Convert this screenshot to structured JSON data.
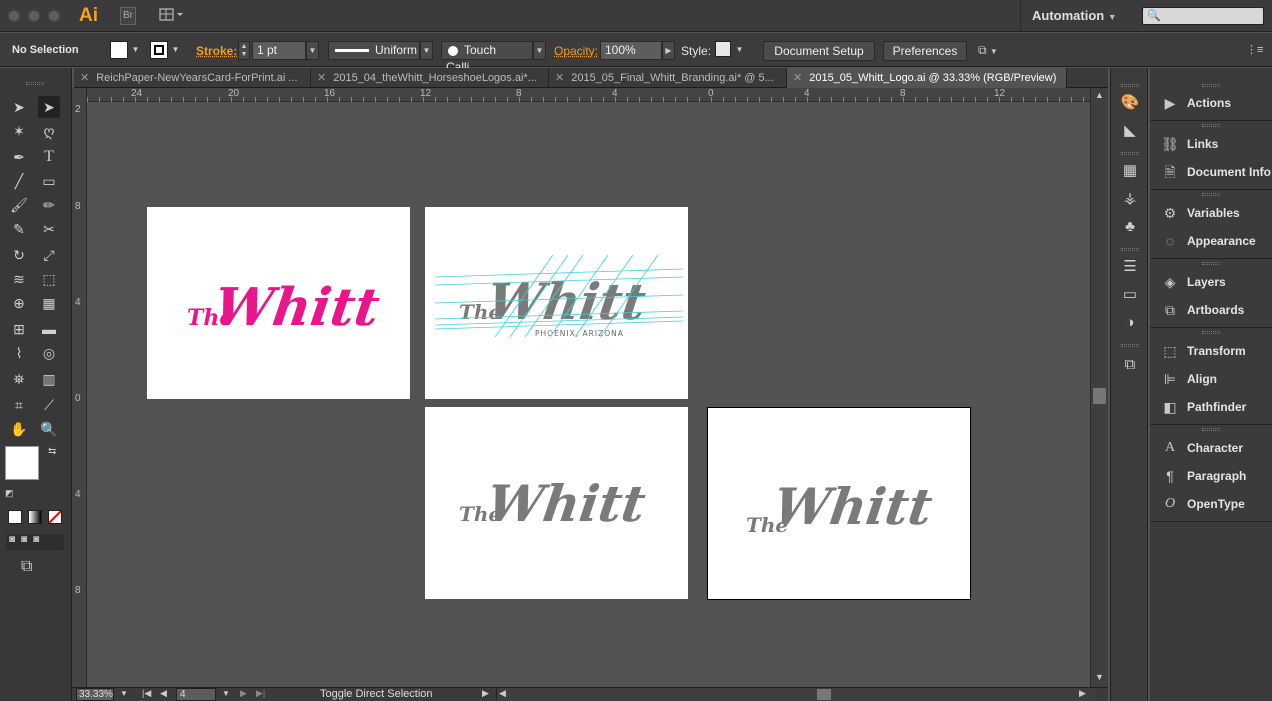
{
  "app": {
    "logo": "Ai",
    "bridge_label": "Br",
    "workspace": "Automation"
  },
  "control_bar": {
    "selection_label": "No Selection",
    "stroke_label": "Stroke:",
    "stroke_value": "1 pt",
    "profile_value": "Uniform",
    "brush_value": "Touch Calli...",
    "opacity_label": "Opacity:",
    "opacity_value": "100%",
    "style_label": "Style:",
    "document_setup": "Document Setup",
    "preferences": "Preferences"
  },
  "tabs": [
    {
      "label": "ReichPaper-NewYearsCard-ForPrint.ai ...",
      "active": false
    },
    {
      "label": "2015_04_theWhitt_HorseshoeLogos.ai*...",
      "active": false
    },
    {
      "label": "2015_05_Final_Whitt_Branding.ai* @ 5...",
      "active": false
    },
    {
      "label": "2015_05_Whitt_Logo.ai @ 33.33% (RGB/Preview)",
      "active": true
    }
  ],
  "rulers": {
    "top": [
      "24",
      "20",
      "16",
      "12",
      "8",
      "4",
      "0",
      "4",
      "8",
      "12"
    ],
    "left": [
      "2",
      "8",
      "4",
      "0",
      "4",
      "8"
    ]
  },
  "artboards": [
    {
      "logo_the": "The",
      "logo_main": "Whitt",
      "subtitle": "",
      "color": "#e8168a"
    },
    {
      "logo_the": "The",
      "logo_main": "Whitt",
      "subtitle": "PHOENIX, ARIZONA",
      "color": "#7a7a7a"
    },
    {
      "logo_the": "The",
      "logo_main": "Whitt",
      "subtitle": "",
      "color": "#7a7a7a"
    },
    {
      "logo_the": "The",
      "logo_main": "Whitt",
      "subtitle": "",
      "color": "#7a7a7a"
    }
  ],
  "status_bar": {
    "zoom": "33.33%",
    "artboard_number": "4",
    "status_text": "Toggle Direct Selection"
  },
  "panels": [
    {
      "label": "Actions",
      "icon": "play-icon"
    },
    {
      "label": "Links",
      "icon": "link-icon"
    },
    {
      "label": "Document Info",
      "icon": "document-info-icon"
    },
    {
      "label": "Variables",
      "icon": "variables-icon"
    },
    {
      "label": "Appearance",
      "icon": "appearance-icon"
    },
    {
      "label": "Layers",
      "icon": "layers-icon"
    },
    {
      "label": "Artboards",
      "icon": "artboards-icon"
    },
    {
      "label": "Transform",
      "icon": "transform-icon"
    },
    {
      "label": "Align",
      "icon": "align-icon"
    },
    {
      "label": "Pathfinder",
      "icon": "pathfinder-icon"
    },
    {
      "label": "Character",
      "icon": "character-icon"
    },
    {
      "label": "Paragraph",
      "icon": "paragraph-icon"
    },
    {
      "label": "OpenType",
      "icon": "opentype-icon"
    }
  ],
  "colors": {
    "accent_orange": "#f49c20",
    "logo_pink": "#e8168a",
    "logo_gray": "#7a7a7a",
    "guide_cyan": "#3fd3d3"
  }
}
